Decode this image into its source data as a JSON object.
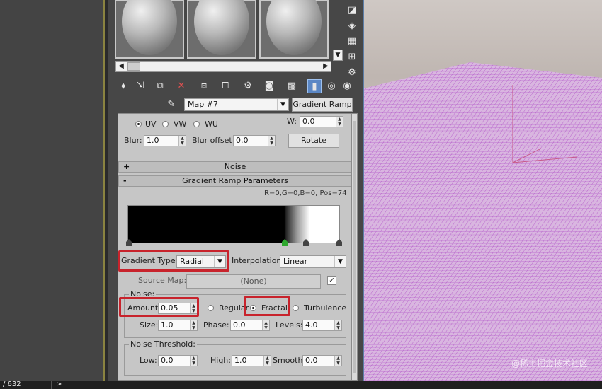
{
  "toolbar": {
    "map_name": "Map #7",
    "map_type": "Gradient Ramp"
  },
  "coordinates": {
    "uv": "UV",
    "vw": "VW",
    "wu": "WU",
    "w_label": "W:",
    "w_value": "0.0",
    "blur_label": "Blur:",
    "blur_value": "1.0",
    "blur_offset_label": "Blur offset:",
    "blur_offset_value": "0.0",
    "rotate_label": "Rotate"
  },
  "noise_rollout": {
    "sign": "+",
    "title": "Noise"
  },
  "gradient_rollout": {
    "sign": "-",
    "title": "Gradient Ramp Parameters",
    "flag_info": "R=0,G=0,B=0, Pos=74",
    "gradient_type_label": "Gradient Type:",
    "gradient_type_value": "Radial",
    "interpolation_label": "Interpolation:",
    "interpolation_value": "Linear",
    "source_map_label": "Source Map:",
    "source_map_value": "(None)",
    "source_map_checked": "✓"
  },
  "noise_group": {
    "title": "Noise:",
    "amount_label": "Amount:",
    "amount_value": "0.05",
    "regular_label": "Regular",
    "fractal_label": "Fractal",
    "turbulence_label": "Turbulence",
    "size_label": "Size:",
    "size_value": "1.0",
    "phase_label": "Phase:",
    "phase_value": "0.0",
    "levels_label": "Levels:",
    "levels_value": "4.0"
  },
  "threshold_group": {
    "title": "Noise Threshold:",
    "low_label": "Low:",
    "low_value": "0.0",
    "high_label": "High:",
    "high_value": "1.0",
    "smooth_label": "Smooth:",
    "smooth_value": "0.0"
  },
  "status": {
    "frame": "/ 632",
    "arrow": ">"
  },
  "watermark": "@稀土掘金技术社区",
  "colors": {
    "highlight": "#c8232c",
    "active_tool": "#5b87c5",
    "mesh": "#b04fc8"
  }
}
